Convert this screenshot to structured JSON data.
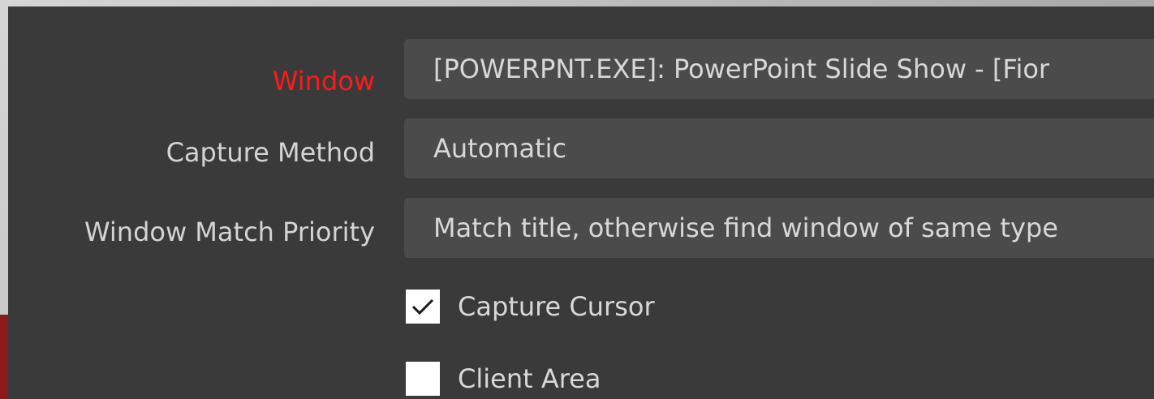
{
  "window_field": {
    "label": "Window",
    "value": "[POWERPNT.EXE]: PowerPoint Slide Show - [Fior",
    "label_color": "#ff1a1a"
  },
  "capture_method_field": {
    "label": "Capture Method",
    "value": "Automatic"
  },
  "match_priority_field": {
    "label": "Window Match Priority",
    "value": "Match title, otherwise find window of same type"
  },
  "capture_cursor": {
    "label": "Capture Cursor",
    "checked": true,
    "icon": "checkmark-icon"
  },
  "client_area": {
    "label": "Client Area",
    "checked": false
  },
  "colors": {
    "panel_background": "#3a3a3a",
    "field_background": "#4b4b4b",
    "text": "#d8d8d8"
  }
}
